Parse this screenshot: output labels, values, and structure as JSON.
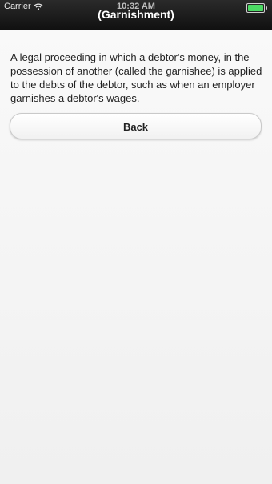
{
  "status_bar": {
    "carrier": "Carrier",
    "time": "10:32 AM",
    "wifi_icon": "wifi-icon",
    "battery_icon": "battery-icon",
    "battery_level": 1.0,
    "battery_color": "#4cd964"
  },
  "header": {
    "title": "(Garnishment)"
  },
  "main": {
    "definition": "A legal proceeding in which a debtor's money, in the possession of another (called the garnishee) is applied to the debts of the debtor, such as when an employer garnishes a debtor's wages.",
    "back_label": "Back"
  }
}
